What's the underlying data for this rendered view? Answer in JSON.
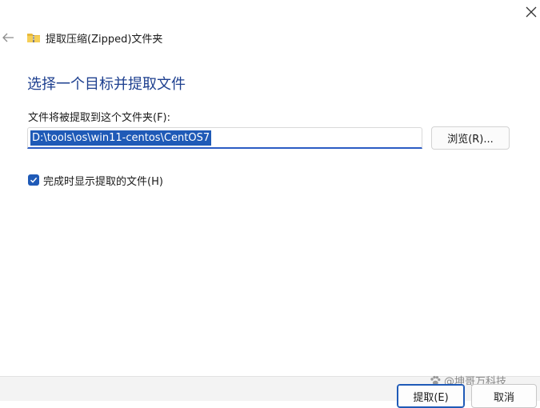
{
  "window": {
    "title": "提取压缩(Zipped)文件夹"
  },
  "heading": "选择一个目标并提取文件",
  "destination": {
    "label": "文件将被提取到这个文件夹(F):",
    "path": "D:\\tools\\os\\win11-centos\\CentOS7",
    "browse_label": "浏览(R)..."
  },
  "options": {
    "show_files_label": "完成时显示提取的文件(H)",
    "show_files_checked": true
  },
  "footer": {
    "extract_label": "提取(E)",
    "cancel_label": "取消",
    "watermark": "@坤哥万科技"
  },
  "icons": {
    "close": "close-icon",
    "back": "back-arrow-icon",
    "folder": "zipped-folder-icon",
    "check": "checkmark-icon",
    "watermark_logo": "paw-icon"
  },
  "colors": {
    "accent": "#1f5ab7",
    "heading": "#1d3f8f",
    "footer_bg": "#f3f3f3"
  }
}
